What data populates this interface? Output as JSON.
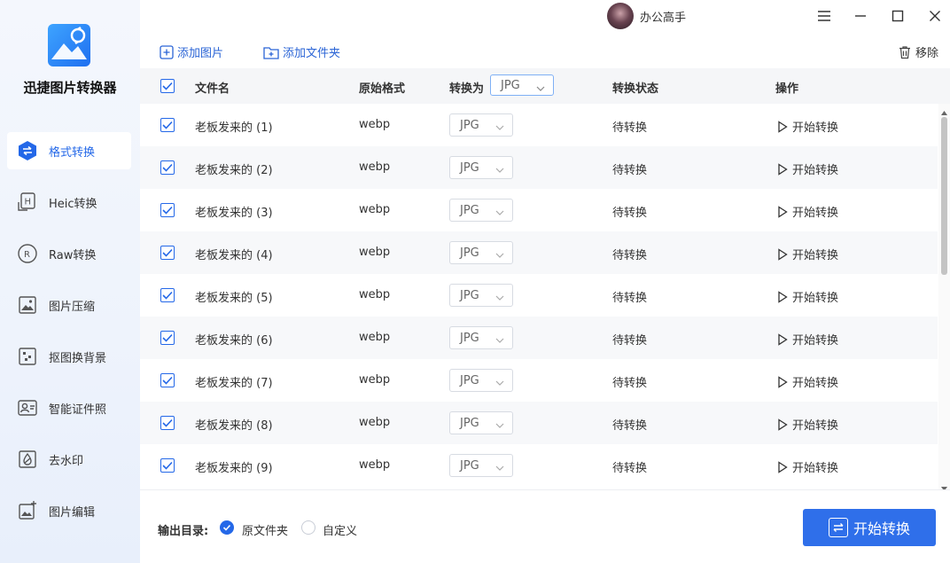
{
  "app": {
    "name": "迅捷图片转换器",
    "user": "办公高手"
  },
  "sidebar": {
    "items": [
      {
        "label": "格式转换",
        "icon": "format-convert-icon",
        "active": true
      },
      {
        "label": "Heic转换",
        "icon": "heic-icon",
        "active": false
      },
      {
        "label": "Raw转换",
        "icon": "raw-icon",
        "active": false
      },
      {
        "label": "图片压缩",
        "icon": "image-compress-icon",
        "active": false
      },
      {
        "label": "抠图换背景",
        "icon": "cutout-icon",
        "active": false
      },
      {
        "label": "智能证件照",
        "icon": "id-photo-icon",
        "active": false
      },
      {
        "label": "去水印",
        "icon": "watermark-icon",
        "active": false
      },
      {
        "label": "图片编辑",
        "icon": "image-edit-icon",
        "active": false
      }
    ]
  },
  "toolbar": {
    "add_image": "添加图片",
    "add_folder": "添加文件夹",
    "remove": "移除"
  },
  "table": {
    "headers": {
      "filename": "文件名",
      "original_format": "原始格式",
      "convert_to": "转换为",
      "convert_to_value": "JPG",
      "status": "转换状态",
      "action": "操作"
    },
    "rows": [
      {
        "name": "老板发来的 (1)",
        "format": "webp",
        "target": "JPG",
        "status": "待转换",
        "action": "开始转换",
        "checked": true
      },
      {
        "name": "老板发来的 (2)",
        "format": "webp",
        "target": "JPG",
        "status": "待转换",
        "action": "开始转换",
        "checked": true
      },
      {
        "name": "老板发来的 (3)",
        "format": "webp",
        "target": "JPG",
        "status": "待转换",
        "action": "开始转换",
        "checked": true
      },
      {
        "name": "老板发来的 (4)",
        "format": "webp",
        "target": "JPG",
        "status": "待转换",
        "action": "开始转换",
        "checked": true
      },
      {
        "name": "老板发来的 (5)",
        "format": "webp",
        "target": "JPG",
        "status": "待转换",
        "action": "开始转换",
        "checked": true
      },
      {
        "name": "老板发来的 (6)",
        "format": "webp",
        "target": "JPG",
        "status": "待转换",
        "action": "开始转换",
        "checked": true
      },
      {
        "name": "老板发来的 (7)",
        "format": "webp",
        "target": "JPG",
        "status": "待转换",
        "action": "开始转换",
        "checked": true
      },
      {
        "name": "老板发来的 (8)",
        "format": "webp",
        "target": "JPG",
        "status": "待转换",
        "action": "开始转换",
        "checked": true
      },
      {
        "name": "老板发来的 (9)",
        "format": "webp",
        "target": "JPG",
        "status": "待转换",
        "action": "开始转换",
        "checked": true
      }
    ]
  },
  "footer": {
    "output_label": "输出目录:",
    "option_original": "原文件夹",
    "option_custom": "自定义",
    "start_button": "开始转换"
  },
  "colors": {
    "accent": "#2f6fea",
    "sidebar_bg": "#eef3fc"
  }
}
